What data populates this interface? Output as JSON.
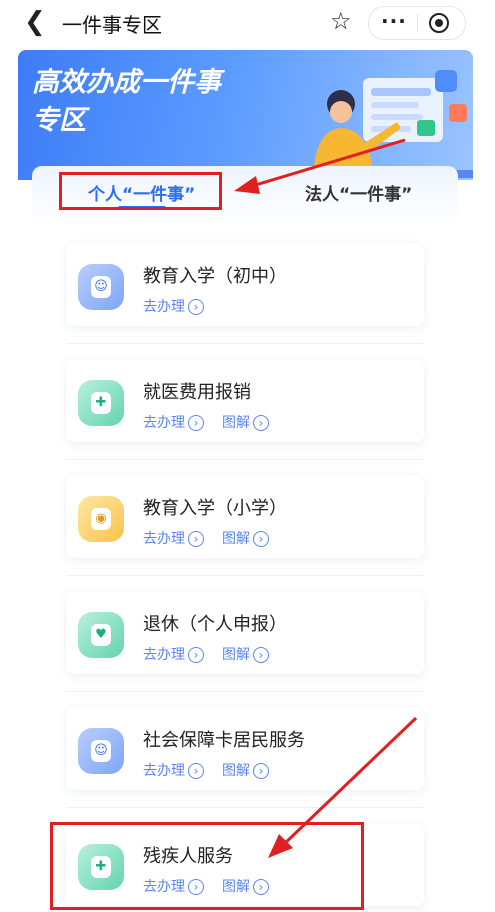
{
  "nav": {
    "title": "一件事专区",
    "back_icon": "chevron-left-icon",
    "star_icon": "star-icon",
    "more_icon": "more-dots-icon",
    "target_icon": "target-icon"
  },
  "banner": {
    "title_line1": "高效办成一件事",
    "title_line2": "专区"
  },
  "tabs": [
    {
      "label": "个人“一件事”",
      "active": true
    },
    {
      "label": "法人“一件事”",
      "active": false
    }
  ],
  "services": [
    {
      "title": "教育入学（初中）",
      "go": "去办理",
      "diagram": "",
      "icon": "student-icon",
      "icon_color": "blue"
    },
    {
      "title": "就医费用报销",
      "go": "去办理",
      "diagram": "图解",
      "icon": "medical-icon",
      "icon_color": "green"
    },
    {
      "title": "教育入学（小学）",
      "go": "去办理",
      "diagram": "图解",
      "icon": "school-icon",
      "icon_color": "yellow"
    },
    {
      "title": "退休（个人申报）",
      "go": "去办理",
      "diagram": "图解",
      "icon": "retire-icon",
      "icon_color": "green"
    },
    {
      "title": "社会保障卡居民服务",
      "go": "去办理",
      "diagram": "图解",
      "icon": "card-icon",
      "icon_color": "blue"
    },
    {
      "title": "残疾人服务",
      "go": "去办理",
      "diagram": "图解",
      "icon": "disability-icon",
      "icon_color": "green"
    }
  ],
  "colors": {
    "accent": "#2b6ef5",
    "highlight": "#e02020"
  }
}
